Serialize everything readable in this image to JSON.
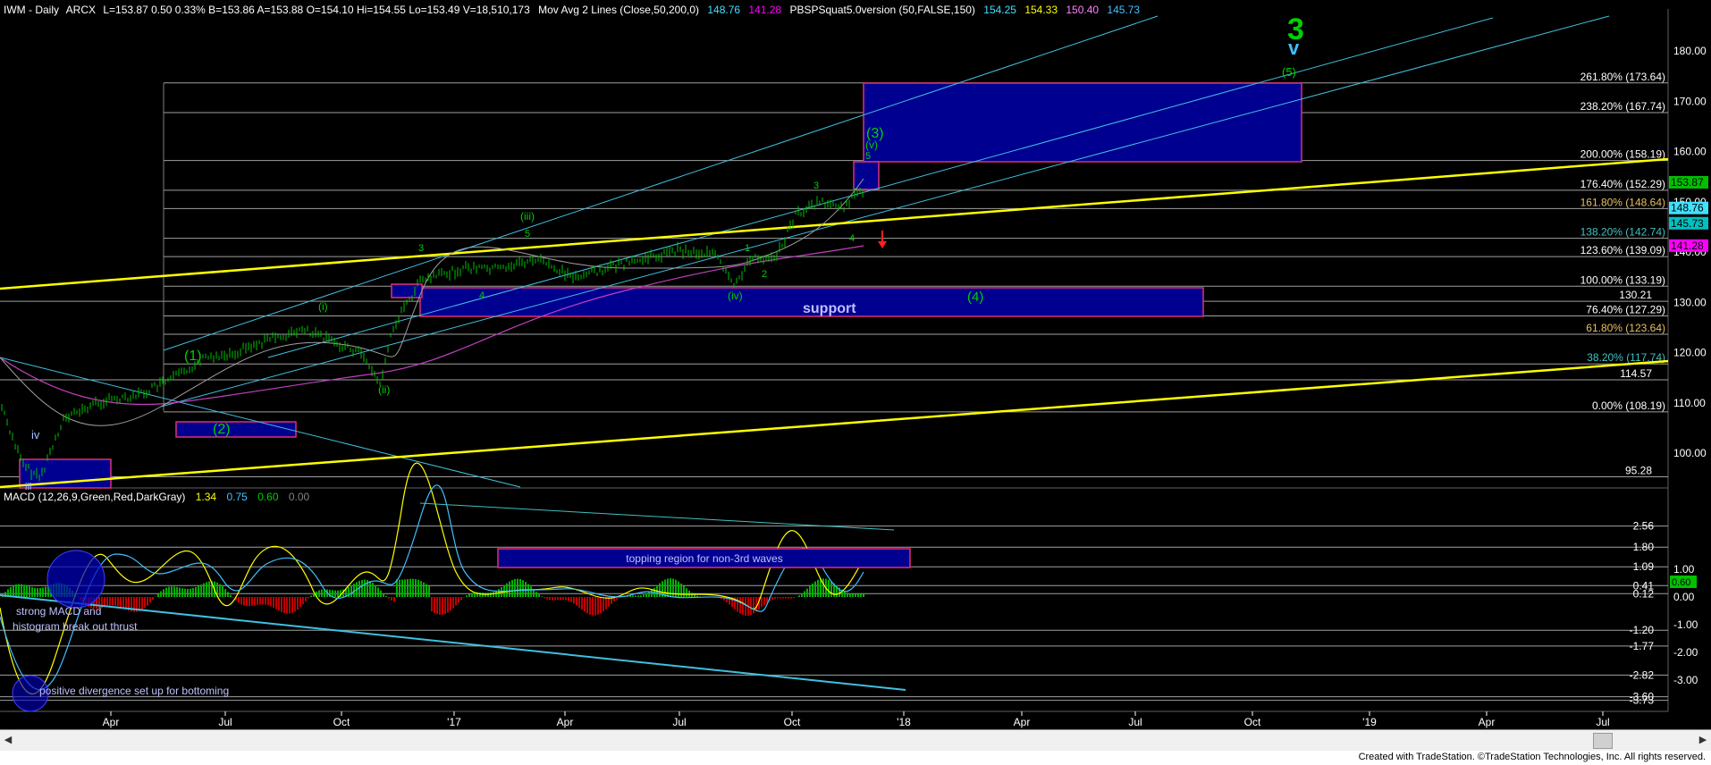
{
  "header": {
    "symbol": "IWM - Daily",
    "exchange": "ARCX",
    "quote": "L=153.87  0.50  0.33%  B=153.86  A=153.88  O=154.10  Hi=154.55  Lo=153.49  V=18,510,173",
    "ma_label": "Mov Avg 2 Lines (Close,50,200,0)",
    "ma_values": [
      "148.76",
      "141.28"
    ],
    "study_label": "PBSPSquat5.0version (50,FALSE,150)",
    "study_values": [
      "154.25",
      "154.33",
      "150.40",
      "145.73"
    ]
  },
  "x_axis_labels": [
    "Apr",
    "Jul",
    "Oct",
    "'17",
    "Apr",
    "Jul",
    "Oct",
    "'18",
    "Apr",
    "Jul",
    "Oct",
    "'19",
    "Apr",
    "Jul"
  ],
  "price_ticks": [
    "180.00",
    "170.00",
    "160.00",
    "150.00",
    "140.00",
    "130.00",
    "120.00",
    "110.00",
    "100.00"
  ],
  "fib_levels": [
    {
      "label": "261.80% (173.64)",
      "value": 173.64,
      "color": "#ffffff"
    },
    {
      "label": "238.20% (167.74)",
      "value": 167.74,
      "color": "#ffffff"
    },
    {
      "label": "200.00% (158.19)",
      "value": 158.19,
      "color": "#ffffff"
    },
    {
      "label": "176.40% (152.29)",
      "value": 152.29,
      "color": "#ffffff"
    },
    {
      "label": "161.80% (148.64)",
      "value": 148.64,
      "color": "#e8c060"
    },
    {
      "label": "138.20% (142.74)",
      "value": 142.74,
      "color": "#40c0c0"
    },
    {
      "label": "123.60% (139.09)",
      "value": 139.09,
      "color": "#ffffff"
    },
    {
      "label": "100.00% (133.19)",
      "value": 133.19,
      "color": "#ffffff"
    },
    {
      "label": "76.40% (127.29)",
      "value": 127.29,
      "color": "#ffffff"
    },
    {
      "label": "61.80% (123.64)",
      "value": 123.64,
      "color": "#e8c060"
    },
    {
      "label": "38.20% (117.74)",
      "value": 117.74,
      "color": "#40c0c0"
    },
    {
      "label": "0.00% (108.19)",
      "value": 108.19,
      "color": "#ffffff"
    }
  ],
  "price_levels": [
    {
      "label": "130.21",
      "value": 130.21
    },
    {
      "label": "114.57",
      "value": 114.57
    },
    {
      "label": "95.28",
      "value": 95.28
    }
  ],
  "price_badges": [
    {
      "label": "153.87",
      "value": 153.87,
      "bg": "#00c000",
      "fg": "#000000"
    },
    {
      "label": "148.76",
      "value": 148.76,
      "bg": "#40e0ff",
      "fg": "#000000"
    },
    {
      "label": "145.73",
      "value": 145.73,
      "bg": "#00c0c0",
      "fg": "#000000"
    },
    {
      "label": "141.28",
      "value": 141.28,
      "bg": "#ff00ff",
      "fg": "#000000"
    }
  ],
  "wave_labels": [
    {
      "text": "3",
      "color": "#00d000",
      "big": true
    },
    {
      "text": "v",
      "color": "#40c0ff",
      "big": true
    },
    {
      "text": "(5)",
      "color": "#00d000"
    },
    {
      "text": "(3)",
      "color": "#00d000"
    },
    {
      "text": "(v)",
      "color": "#00d000"
    },
    {
      "text": "5",
      "color": "#00d000"
    },
    {
      "text": "3",
      "color": "#00d000"
    },
    {
      "text": "(iii)",
      "color": "#00d000"
    },
    {
      "text": "5",
      "color": "#00d000"
    },
    {
      "text": "3",
      "color": "#00d000"
    },
    {
      "text": "4",
      "color": "#00d000"
    },
    {
      "text": "1",
      "color": "#00d000"
    },
    {
      "text": "2",
      "color": "#00d000"
    },
    {
      "text": "4",
      "color": "#00d000"
    },
    {
      "text": "(iv)",
      "color": "#00d000"
    },
    {
      "text": "(4)",
      "color": "#00d000"
    },
    {
      "text": "(i)",
      "color": "#00d000"
    },
    {
      "text": "(ii)",
      "color": "#00d000"
    },
    {
      "text": "(1)",
      "color": "#00d000"
    },
    {
      "text": "(2)",
      "color": "#00d000"
    },
    {
      "text": "iv",
      "color": "#a0c0ff"
    },
    {
      "text": "iii",
      "color": "#a0c0ff"
    }
  ],
  "support_label": "support",
  "macd": {
    "header": "MACD (12,26,9,Green,Red,DarkGray)",
    "values": [
      {
        "text": "1.34",
        "color": "#ffff00"
      },
      {
        "text": "0.75",
        "color": "#40c0ff"
      },
      {
        "text": "0.60",
        "color": "#00d000"
      },
      {
        "text": "0.00",
        "color": "#808080"
      }
    ],
    "ticks": [
      "1.00",
      "0.00",
      "-1.00",
      "-2.00",
      "-3.00"
    ],
    "levels": [
      "2.56",
      "1.80",
      "1.09",
      "0.41",
      "0.12",
      "-1.20",
      "-1.77",
      "-2.82",
      "-3.73",
      "-3.60"
    ],
    "badge": "0.60",
    "annotations": [
      "topping region for non-3rd waves",
      "strong MACD  and",
      "histogram break out thrust",
      "positive divergence set up for bottoming"
    ]
  },
  "footer": "Created with TradeStation. ©TradeStation Technologies, Inc. All rights reserved."
}
